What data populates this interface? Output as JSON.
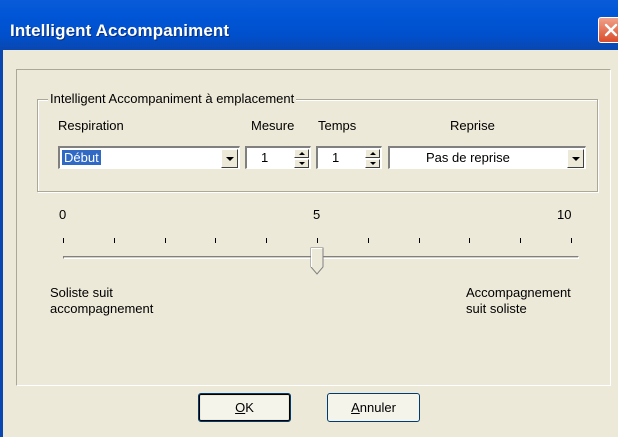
{
  "window": {
    "title": "Intelligent Accompaniment",
    "close_icon": "close-icon",
    "title_bar_color": "#0054E3",
    "close_color": "#D94D2B"
  },
  "group": {
    "legend": "Intelligent Accompaniment à emplacement"
  },
  "columns": {
    "respiration": "Respiration",
    "mesure": "Mesure",
    "temps": "Temps",
    "reprise": "Reprise"
  },
  "fields": {
    "respiration_value": "Début",
    "mesure_value": "1",
    "temps_value": "1",
    "reprise_value": "Pas de reprise"
  },
  "slider": {
    "min_label": "0",
    "mid_label": "5",
    "max_label": "10",
    "value": 5,
    "left_caption_line1": "Soliste suit",
    "left_caption_line2": "accompagnement",
    "right_caption_line1": "Accompagnement",
    "right_caption_line2": "suit soliste"
  },
  "buttons": {
    "ok_mnemonic": "O",
    "ok_rest": "K",
    "cancel_mnemonic": "A",
    "cancel_rest": "nnuler"
  }
}
